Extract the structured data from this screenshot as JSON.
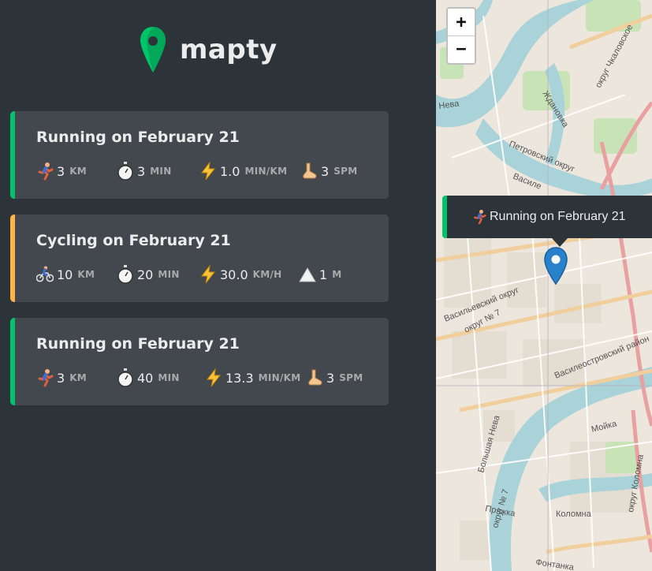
{
  "app": {
    "name": "mapty"
  },
  "workouts": [
    {
      "type": "running",
      "title": "Running on February 21",
      "details": [
        {
          "icon": "running-icon",
          "value": "3",
          "unit": "KM"
        },
        {
          "icon": "stopwatch-icon",
          "value": "3",
          "unit": "MIN"
        },
        {
          "icon": "lightning-icon",
          "value": "1.0",
          "unit": "MIN/KM"
        },
        {
          "icon": "foot-icon",
          "value": "3",
          "unit": "SPM"
        }
      ]
    },
    {
      "type": "cycling",
      "title": "Cycling on February 21",
      "details": [
        {
          "icon": "cycling-icon",
          "value": "10",
          "unit": "KM"
        },
        {
          "icon": "stopwatch-icon",
          "value": "20",
          "unit": "MIN"
        },
        {
          "icon": "lightning-icon",
          "value": "30.0",
          "unit": "KM/H"
        },
        {
          "icon": "mountain-icon",
          "value": "1",
          "unit": "M"
        }
      ]
    },
    {
      "type": "running",
      "title": "Running on February 21",
      "details": [
        {
          "icon": "running-icon",
          "value": "3",
          "unit": "KM"
        },
        {
          "icon": "stopwatch-icon",
          "value": "40",
          "unit": "MIN"
        },
        {
          "icon": "lightning-icon",
          "value": "13.3",
          "unit": "MIN/KM"
        },
        {
          "icon": "foot-icon",
          "value": "3",
          "unit": "SPM"
        }
      ]
    }
  ],
  "map": {
    "zoom_in_label": "+",
    "zoom_out_label": "−",
    "popup": {
      "icon": "running-icon",
      "text": "Running on February 21"
    },
    "labels": [
      "Нева",
      "Ждановка",
      "округ Чкаловское",
      "Петровский округ",
      "Василе",
      "Васильевский округ",
      "округ № 7",
      "Василеостровский район",
      "Мойка",
      "Большая Нева",
      "округ № 7",
      "Пряжка",
      "Коломна",
      "округ Коломна",
      "Фонтанка"
    ]
  },
  "colors": {
    "brand": "#00c46a",
    "running": "#00c46a",
    "cycling": "#ffb545",
    "background": "#2d3439",
    "card": "#42484d",
    "marker": "#2a81cb"
  }
}
